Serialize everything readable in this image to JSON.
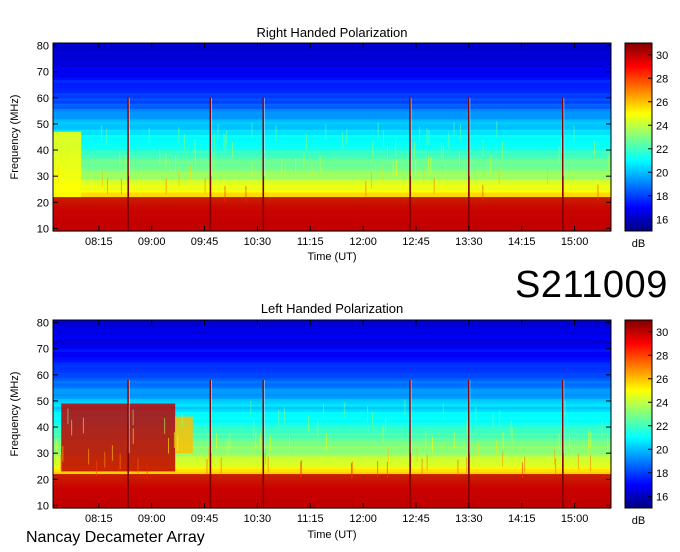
{
  "observation_id": "S211009",
  "instrument": "Nancay Decameter Array",
  "colorbar": {
    "unit": "dB",
    "min": 15,
    "max": 31,
    "ticks": [
      16,
      18,
      20,
      22,
      24,
      26,
      28,
      30
    ],
    "colormap": [
      "#00007f",
      "#0000ff",
      "#0080ff",
      "#00ffff",
      "#80ff80",
      "#ffff00",
      "#ff8000",
      "#ff0000",
      "#7f0000"
    ]
  },
  "chart_data": [
    {
      "type": "heatmap",
      "title": "Right Handed Polarization",
      "xlabel": "Time (UT)",
      "ylabel": "Frequency (MHz)",
      "x_ticks": [
        "08:15",
        "09:00",
        "09:45",
        "10:30",
        "11:15",
        "12:00",
        "12:45",
        "13:30",
        "14:15",
        "15:00"
      ],
      "xlim": [
        "07:36",
        "15:31"
      ],
      "y_ticks": [
        10,
        20,
        30,
        40,
        50,
        60,
        70,
        80
      ],
      "ylim": [
        9,
        81
      ],
      "background_db": [
        [
          9,
          30
        ],
        [
          15,
          29
        ],
        [
          18,
          28
        ],
        [
          22,
          26
        ],
        [
          28,
          24
        ],
        [
          38,
          22
        ],
        [
          50,
          20
        ],
        [
          60,
          18
        ],
        [
          70,
          17
        ],
        [
          81,
          16
        ]
      ],
      "bursts": [
        {
          "t0": "07:36",
          "t1": "15:31",
          "f0": 9,
          "f1": 22,
          "db": 30
        },
        {
          "t0": "07:36",
          "t1": "08:00",
          "f0": 22,
          "f1": 47,
          "db": 25
        }
      ],
      "spikes": [
        "08:40",
        "09:50",
        "10:35",
        "12:40",
        "13:30",
        "14:50"
      ],
      "spike_labels": {
        "top": 60
      }
    },
    {
      "type": "heatmap",
      "title": "Left Handed Polarization",
      "xlabel": "Time (UT)",
      "ylabel": "Frequency (MHz)",
      "x_ticks": [
        "08:15",
        "09:00",
        "09:45",
        "10:30",
        "11:15",
        "12:00",
        "12:45",
        "13:30",
        "14:15",
        "15:00"
      ],
      "xlim": [
        "07:36",
        "15:31"
      ],
      "y_ticks": [
        10,
        20,
        30,
        40,
        50,
        60,
        70,
        80
      ],
      "ylim": [
        9,
        81
      ],
      "background_db": [
        [
          9,
          30
        ],
        [
          15,
          29
        ],
        [
          18,
          28
        ],
        [
          22,
          26
        ],
        [
          28,
          24
        ],
        [
          38,
          22
        ],
        [
          50,
          20
        ],
        [
          60,
          18
        ],
        [
          70,
          17
        ],
        [
          81,
          16
        ]
      ],
      "bursts": [
        {
          "t0": "07:36",
          "t1": "15:31",
          "f0": 9,
          "f1": 22,
          "db": 30
        },
        {
          "t0": "07:43",
          "t1": "09:20",
          "f0": 23,
          "f1": 49,
          "db": 30
        },
        {
          "t0": "09:20",
          "t1": "09:35",
          "f0": 30,
          "f1": 44,
          "db": 26
        }
      ],
      "spikes": [
        "08:40",
        "09:50",
        "10:35",
        "12:40",
        "13:30",
        "14:50"
      ],
      "spike_labels": {
        "top": 58
      }
    }
  ]
}
